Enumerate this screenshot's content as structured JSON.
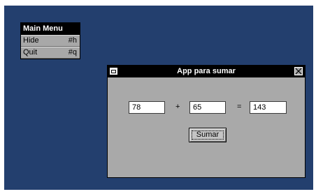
{
  "menu": {
    "title": "Main Menu",
    "items": [
      {
        "label": "Hide",
        "accelerator": "#h"
      },
      {
        "label": "Quit",
        "accelerator": "#q"
      }
    ]
  },
  "window": {
    "title": "App para sumar",
    "menu_icon": "window-menu-icon",
    "close_icon": "close-icon",
    "operand_a": "78",
    "plus_sign": "+",
    "operand_b": "65",
    "equals_sign": "=",
    "result": "143",
    "button_label": "Sumar"
  },
  "colors": {
    "desktop": "#233f6e",
    "window_body": "#a9a9a9",
    "titlebar": "#000000"
  }
}
